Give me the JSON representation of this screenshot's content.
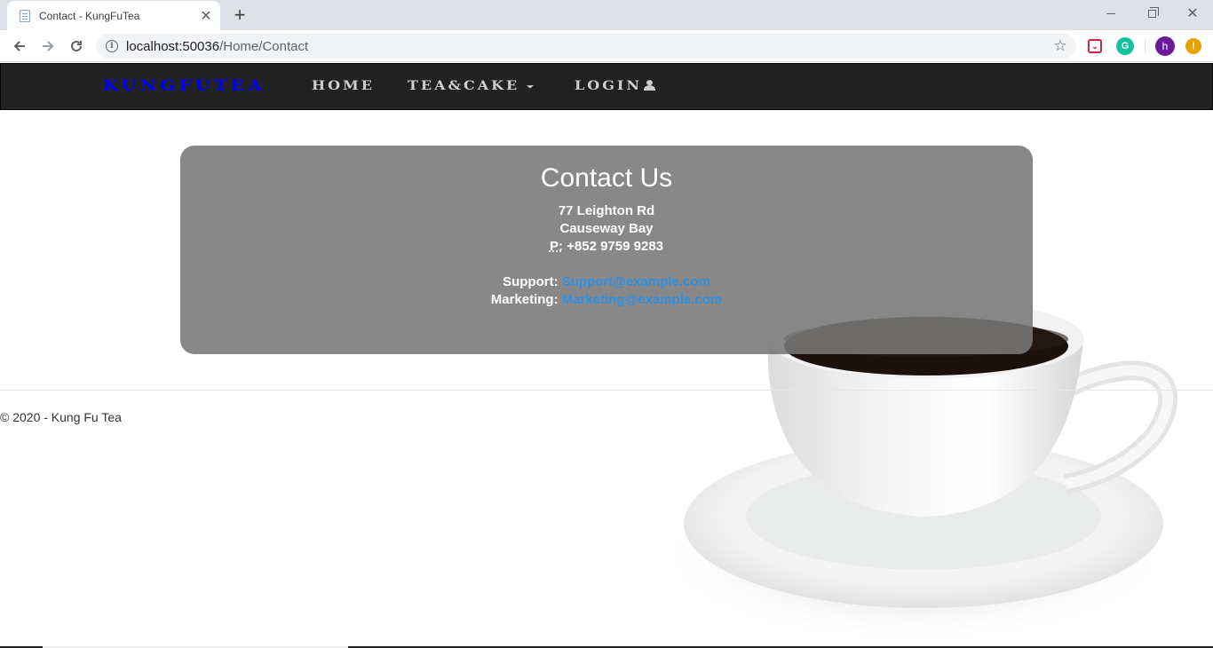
{
  "browser": {
    "tab_title": "Contact - KungFuTea",
    "url_host": "localhost:50036",
    "url_path": "/Home/Contact",
    "avatar_letter": "h",
    "warning_symbol": "!"
  },
  "navbar": {
    "brand": "KungFuTea",
    "home": "Home",
    "tea_cake": "Tea&Cake",
    "login": "Login"
  },
  "contact": {
    "title": "Contact Us",
    "street": "77 Leighton Rd",
    "district": "Causeway Bay",
    "phone_label": "P:",
    "phone": "+852 9759 9283",
    "support_label": "Support:",
    "support_email": "Support@example.com",
    "marketing_label": "Marketing:",
    "marketing_email": "Marketing@example.com"
  },
  "footer": {
    "copyright": "© 2020 - Kung Fu Tea"
  },
  "colors": {
    "brand": "#0000ff",
    "navbar_bg": "#222222",
    "card_bg": "#787878",
    "link": "#2f8fe0"
  }
}
